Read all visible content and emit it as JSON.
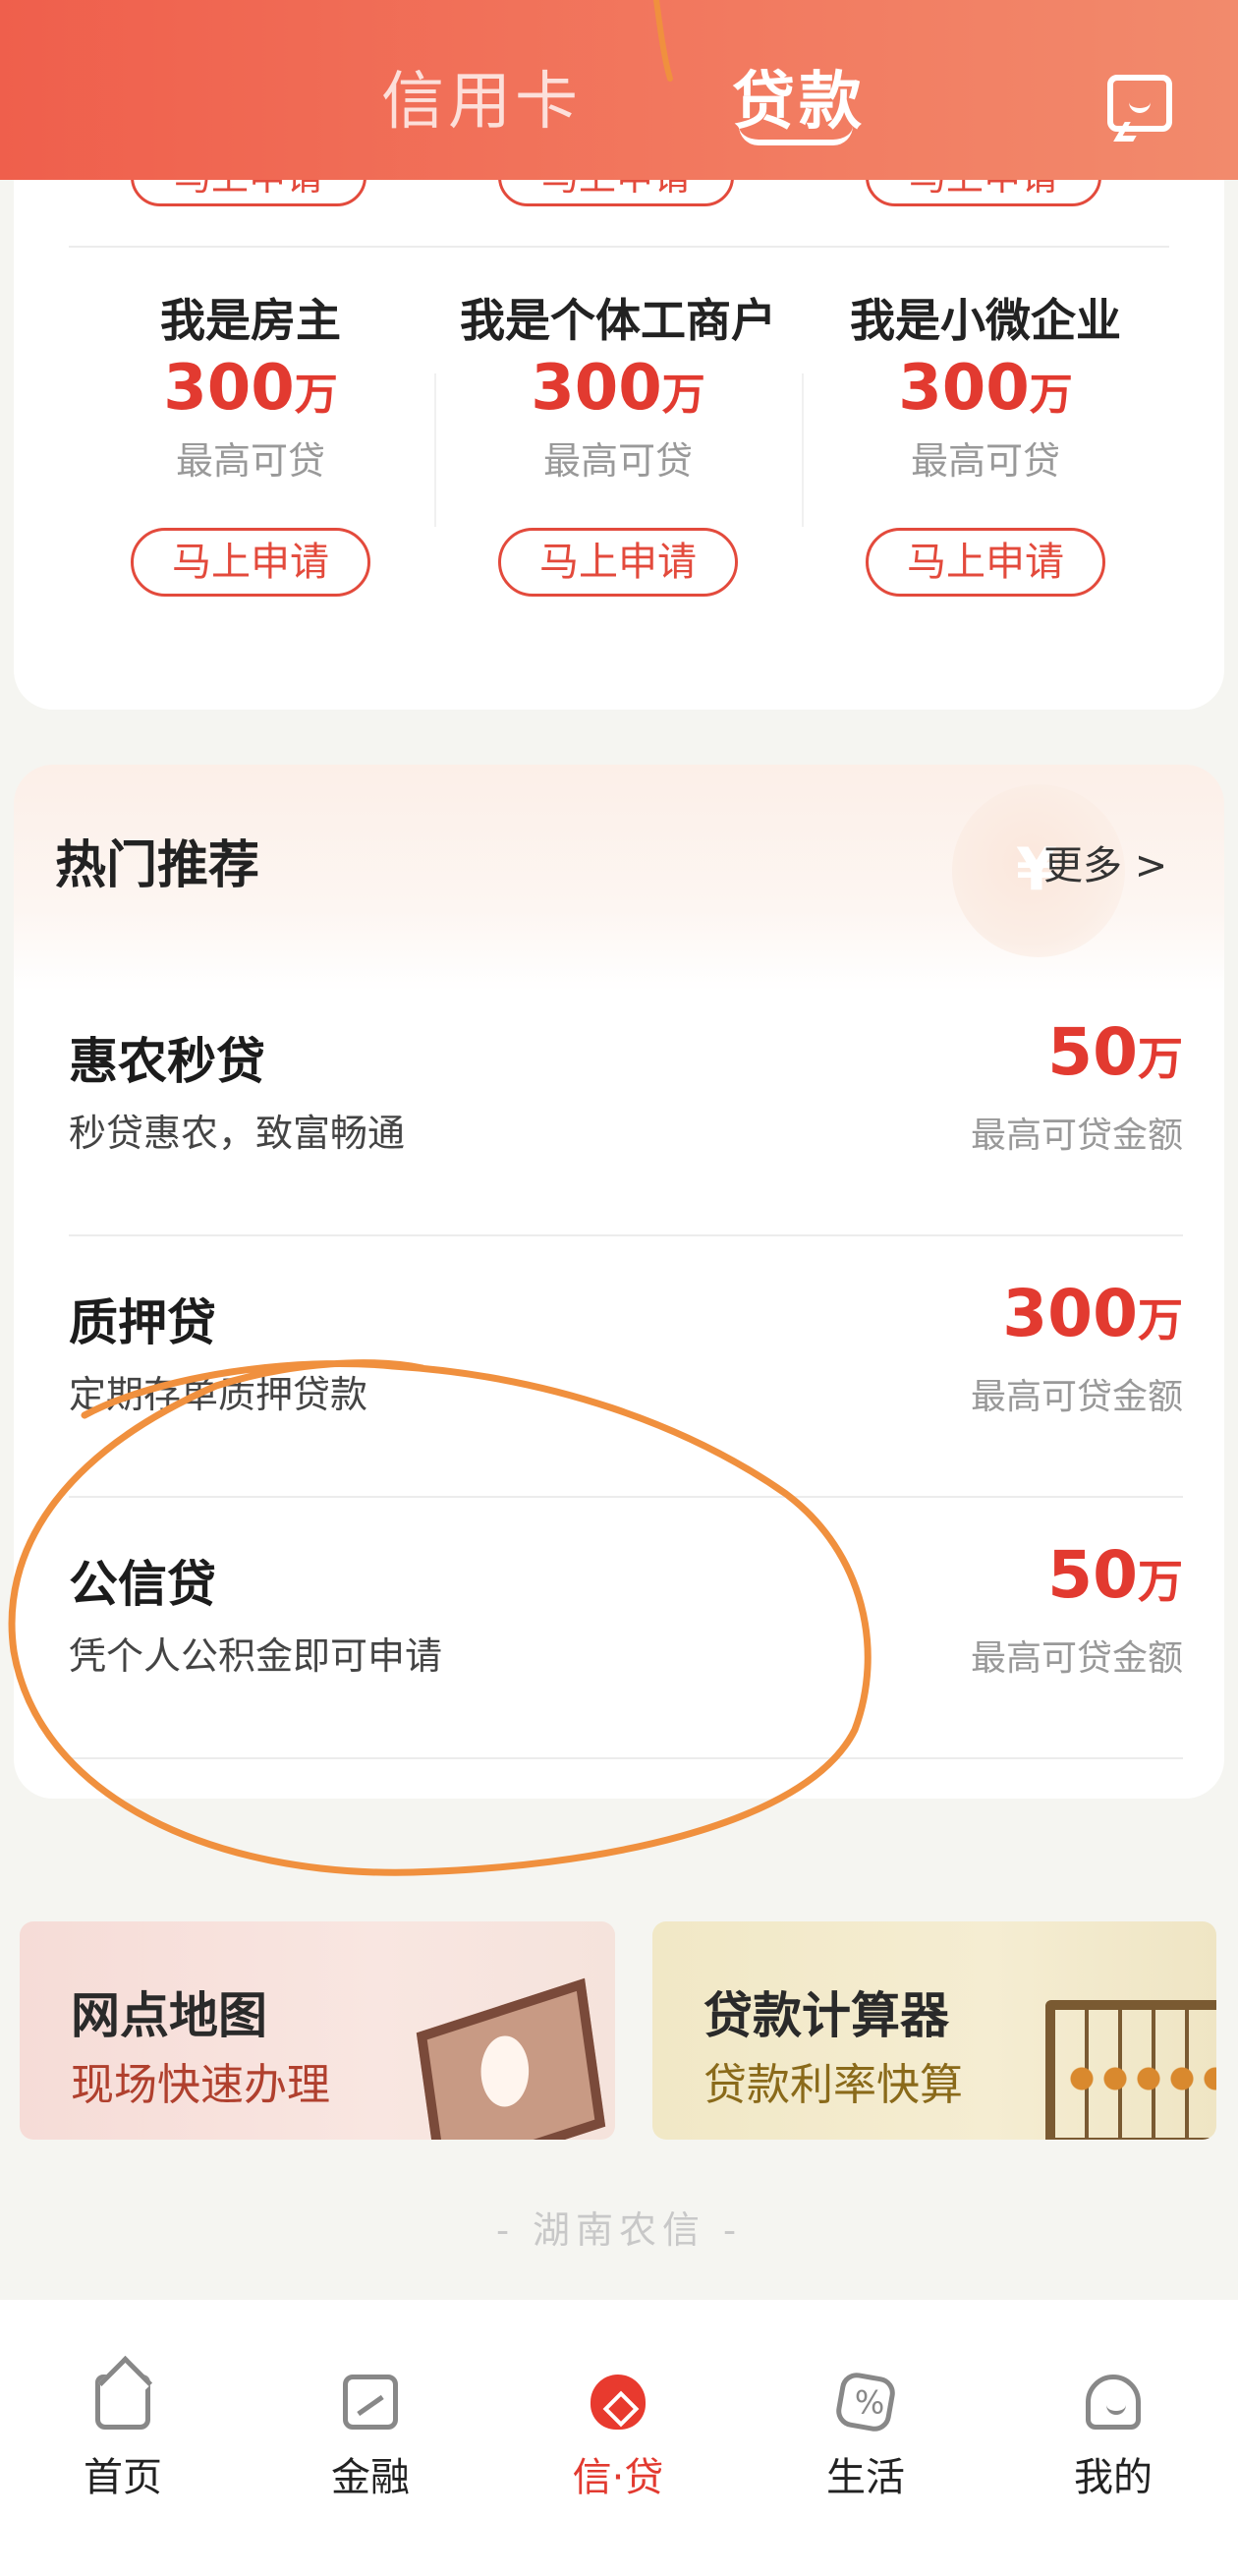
{
  "header": {
    "tabs": [
      {
        "label": "信用卡",
        "active": false
      },
      {
        "label": "贷款",
        "active": true
      }
    ],
    "icon": "message-icon"
  },
  "top_card": {
    "cut_button_label": "马上申请",
    "columns": [
      {
        "title": "我是房主",
        "amount": "300",
        "unit": "万",
        "sub": "最高可贷",
        "button": "马上申请"
      },
      {
        "title": "我是个体工商户",
        "amount": "300",
        "unit": "万",
        "sub": "最高可贷",
        "button": "马上申请"
      },
      {
        "title": "我是小微企业",
        "amount": "300",
        "unit": "万",
        "sub": "最高可贷",
        "button": "马上申请"
      }
    ]
  },
  "hot": {
    "title": "热门推荐",
    "more": "更多 >",
    "items": [
      {
        "name": "惠农秒贷",
        "desc": "秒贷惠农，致富畅通",
        "amount": "50",
        "unit": "万",
        "sub": "最高可贷金额"
      },
      {
        "name": "质押贷",
        "desc": "定期存单质押贷款",
        "amount": "300",
        "unit": "万",
        "sub": "最高可贷金额"
      },
      {
        "name": "公信贷",
        "desc": "凭个人公积金即可申请",
        "amount": "50",
        "unit": "万",
        "sub": "最高可贷金额"
      }
    ]
  },
  "banners": {
    "map": {
      "title": "网点地图",
      "sub": "现场快速办理"
    },
    "calc": {
      "title": "贷款计算器",
      "sub": "贷款利率快算"
    }
  },
  "footer_brand": "- 湖南农信 -",
  "bottom_nav": [
    {
      "label": "首页",
      "icon": "home-icon",
      "active": false
    },
    {
      "label": "金融",
      "icon": "finance-icon",
      "active": false
    },
    {
      "label": "信·贷",
      "icon": "loan-bag-icon",
      "active": true
    },
    {
      "label": "生活",
      "icon": "life-icon",
      "active": false
    },
    {
      "label": "我的",
      "icon": "profile-icon",
      "active": false
    }
  ],
  "colors": {
    "accent": "#e23a30",
    "header": "#ef5f4c",
    "annotation": "#f0903e"
  }
}
